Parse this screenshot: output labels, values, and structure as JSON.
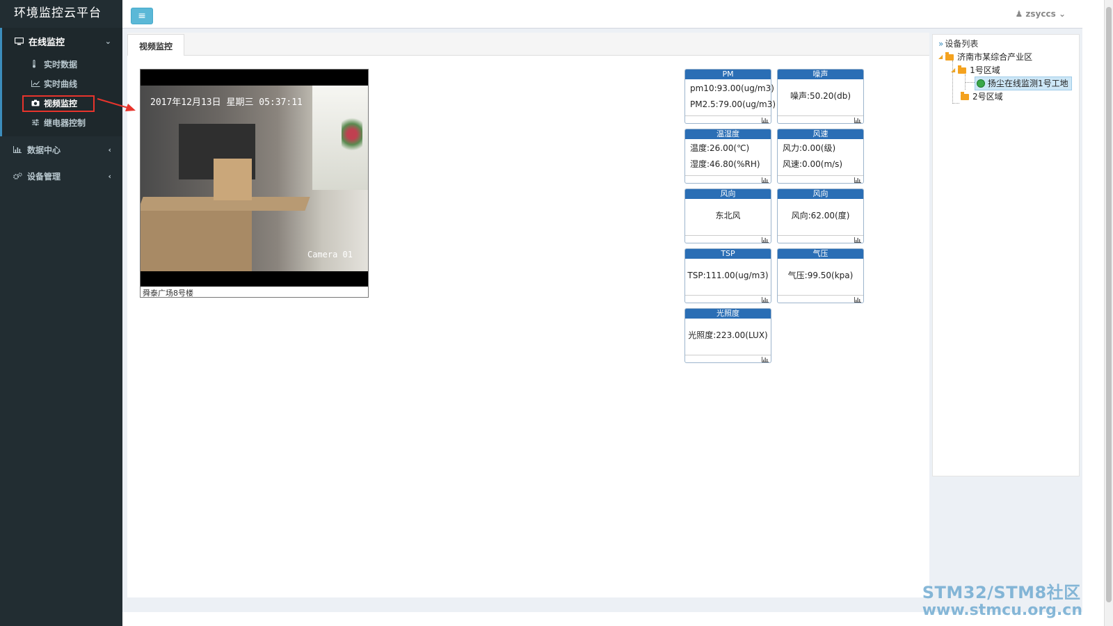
{
  "app": {
    "title": "环境监控云平台",
    "user": "zsyccs"
  },
  "sidebar": {
    "groups": [
      {
        "label": "在线监控",
        "items": [
          {
            "label": "实时数据"
          },
          {
            "label": "实时曲线"
          },
          {
            "label": "视频监控"
          },
          {
            "label": "继电器控制"
          }
        ]
      },
      {
        "label": "数据中心"
      },
      {
        "label": "设备管理"
      }
    ]
  },
  "main": {
    "tab": "视频监控",
    "video": {
      "osd_time": "2017年12月13日 星期三 05:37:11",
      "camera_label": "Camera 01",
      "caption": "舜泰广场8号楼"
    }
  },
  "cards": [
    {
      "title": "PM",
      "lines": [
        "pm10:93.00(ug/m3)",
        "PM2.5:79.00(ug/m3)"
      ]
    },
    {
      "title": "噪声",
      "lines": [
        "噪声:50.20(db)"
      ]
    },
    {
      "title": "温湿度",
      "lines": [
        "温度:26.00(℃)",
        "湿度:46.80(%RH)"
      ]
    },
    {
      "title": "风速",
      "lines": [
        "风力:0.00(级)",
        "风速:0.00(m/s)"
      ]
    },
    {
      "title": "风向",
      "lines": [
        "东北风"
      ]
    },
    {
      "title": "风向",
      "lines": [
        "风向:62.00(度)"
      ]
    },
    {
      "title": "TSP",
      "lines": [
        "TSP:111.00(ug/m3)"
      ]
    },
    {
      "title": "气压",
      "lines": [
        "气压:99.50(kpa)"
      ]
    },
    {
      "title": "光照度",
      "lines": [
        "光照度:223.00(LUX)"
      ]
    }
  ],
  "device_panel": {
    "title": "设备列表",
    "tree": {
      "root": "济南市某综合产业区",
      "area1": "1号区域",
      "device": "扬尘在线监测1号工地",
      "area2": "2号区域"
    }
  },
  "watermark": {
    "line1": "STM32/STM8社区",
    "line2": "www.stmcu.org.cn"
  },
  "colors": {
    "sidebar_bg": "#222d32",
    "card_header": "#2a6eb5",
    "toggle_button": "#5bb8d7",
    "highlight_box": "#e8342c"
  }
}
